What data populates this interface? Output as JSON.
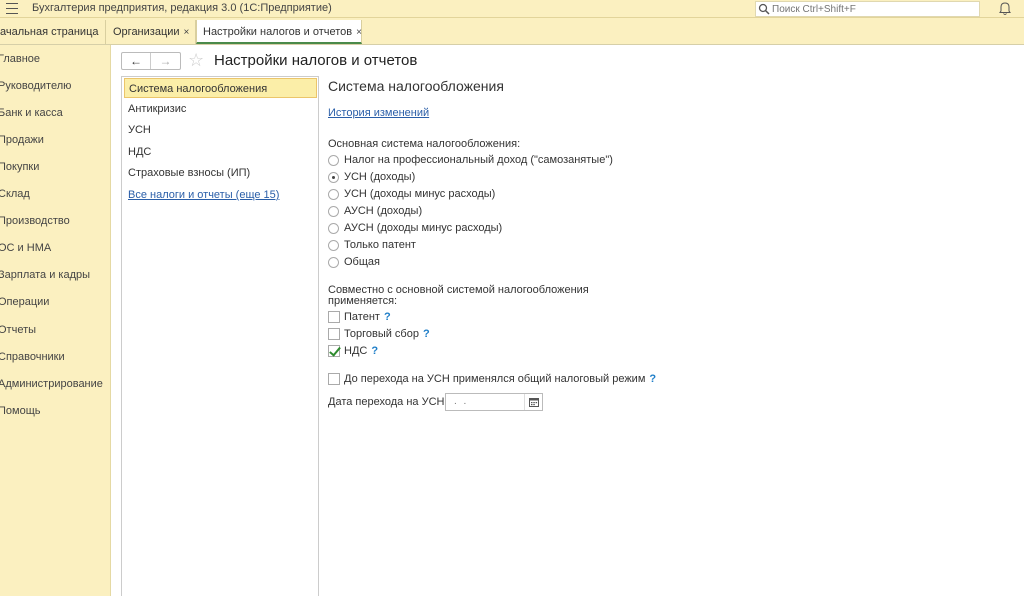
{
  "window": {
    "title": "Бухгалтерия предприятия, редакция 3.0  (1С:Предприятие)",
    "search_placeholder": "Поиск Ctrl+Shift+F"
  },
  "tabs": [
    {
      "label": "ачальная страница"
    },
    {
      "label": "Организации",
      "close": "×"
    },
    {
      "label": "Настройки налогов и отчетов",
      "close": "×"
    }
  ],
  "nav": [
    "Главное",
    "Руководителю",
    "Банк и касса",
    "Продажи",
    "Покупки",
    "Склад",
    "Производство",
    "ОС и НМА",
    "Зарплата и кадры",
    "Операции",
    "Отчеты",
    "Справочники",
    "Администрирование",
    "Помощь"
  ],
  "page": {
    "title": "Настройки налогов и отчетов",
    "back_icon": "←",
    "forward_icon": "→",
    "star_icon": "☆"
  },
  "sections": {
    "items": [
      "Система налогообложения",
      "Антикризис",
      "УСН",
      "НДС",
      "Страховые взносы (ИП)"
    ],
    "all_link": "Все налоги и отчеты (еще 15)"
  },
  "content": {
    "title": "Система налогообложения",
    "history_link": "История изменений",
    "main_system_label": "Основная система налогообложения:",
    "options": [
      {
        "label": "Налог на профессиональный доход (\"самозанятые\")",
        "selected": false
      },
      {
        "label": "УСН (доходы)",
        "selected": true
      },
      {
        "label": "УСН (доходы минус расходы)",
        "selected": false
      },
      {
        "label": "АУСН (доходы)",
        "selected": false
      },
      {
        "label": "АУСН (доходы минус расходы)",
        "selected": false
      },
      {
        "label": "Только патент",
        "selected": false
      },
      {
        "label": "Общая",
        "selected": false
      }
    ],
    "jointly_label_1": "Совместно с основной системой налогообложения",
    "jointly_label_2": "применяется:",
    "checks": [
      {
        "label": "Патент",
        "checked": false,
        "help": "?"
      },
      {
        "label": "Торговый сбор",
        "checked": false,
        "help": "?"
      },
      {
        "label": "НДС",
        "checked": true,
        "help": "?"
      }
    ],
    "before_usn": {
      "label": "До перехода на УСН применялся общий налоговый режим",
      "checked": false,
      "help": "?"
    },
    "transition_date_label": "Дата перехода на УСН:",
    "transition_date_value": " .  .  "
  },
  "colors": {
    "panel_bg": "#fbf0c0",
    "selected_bg": "#fbeea8",
    "link": "#2a5ea8",
    "check": "#2e8b2e"
  }
}
